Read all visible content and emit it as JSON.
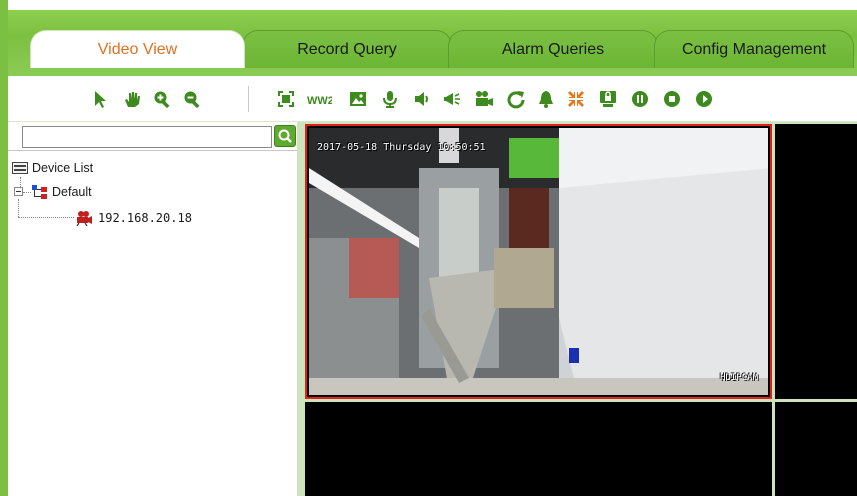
{
  "tabs": [
    {
      "label": "Video View",
      "active": true
    },
    {
      "label": "Record Query",
      "active": false
    },
    {
      "label": "Alarm Queries",
      "active": false
    },
    {
      "label": "Config Management",
      "active": false
    }
  ],
  "colors": {
    "brand_green": "#7bc043",
    "active_tab_text": "#e07020",
    "selected_border": "#e0201a"
  },
  "toolbar": {
    "icons": [
      "pointer-icon",
      "pan-hand-icon",
      "zoom-in-icon",
      "zoom-out-icon",
      "fullscreen-icon",
      "multi-window-icon",
      "snapshot-icon",
      "microphone-icon",
      "speaker-icon",
      "broadcast-icon",
      "record-icon",
      "refresh-icon",
      "alarm-bell-icon",
      "shrink-icon",
      "monitor-lock-icon",
      "pause-icon",
      "stop-icon",
      "play-icon"
    ]
  },
  "sidebar": {
    "search": {
      "value": "",
      "placeholder": ""
    },
    "tree": {
      "root_label": "Device List",
      "group_label": "Default",
      "device_label": "192.168.20.18"
    }
  },
  "video": {
    "osd_time": "2017-05-18  Thursday  10:50:51",
    "osd_brand": "HDIPCAM"
  }
}
